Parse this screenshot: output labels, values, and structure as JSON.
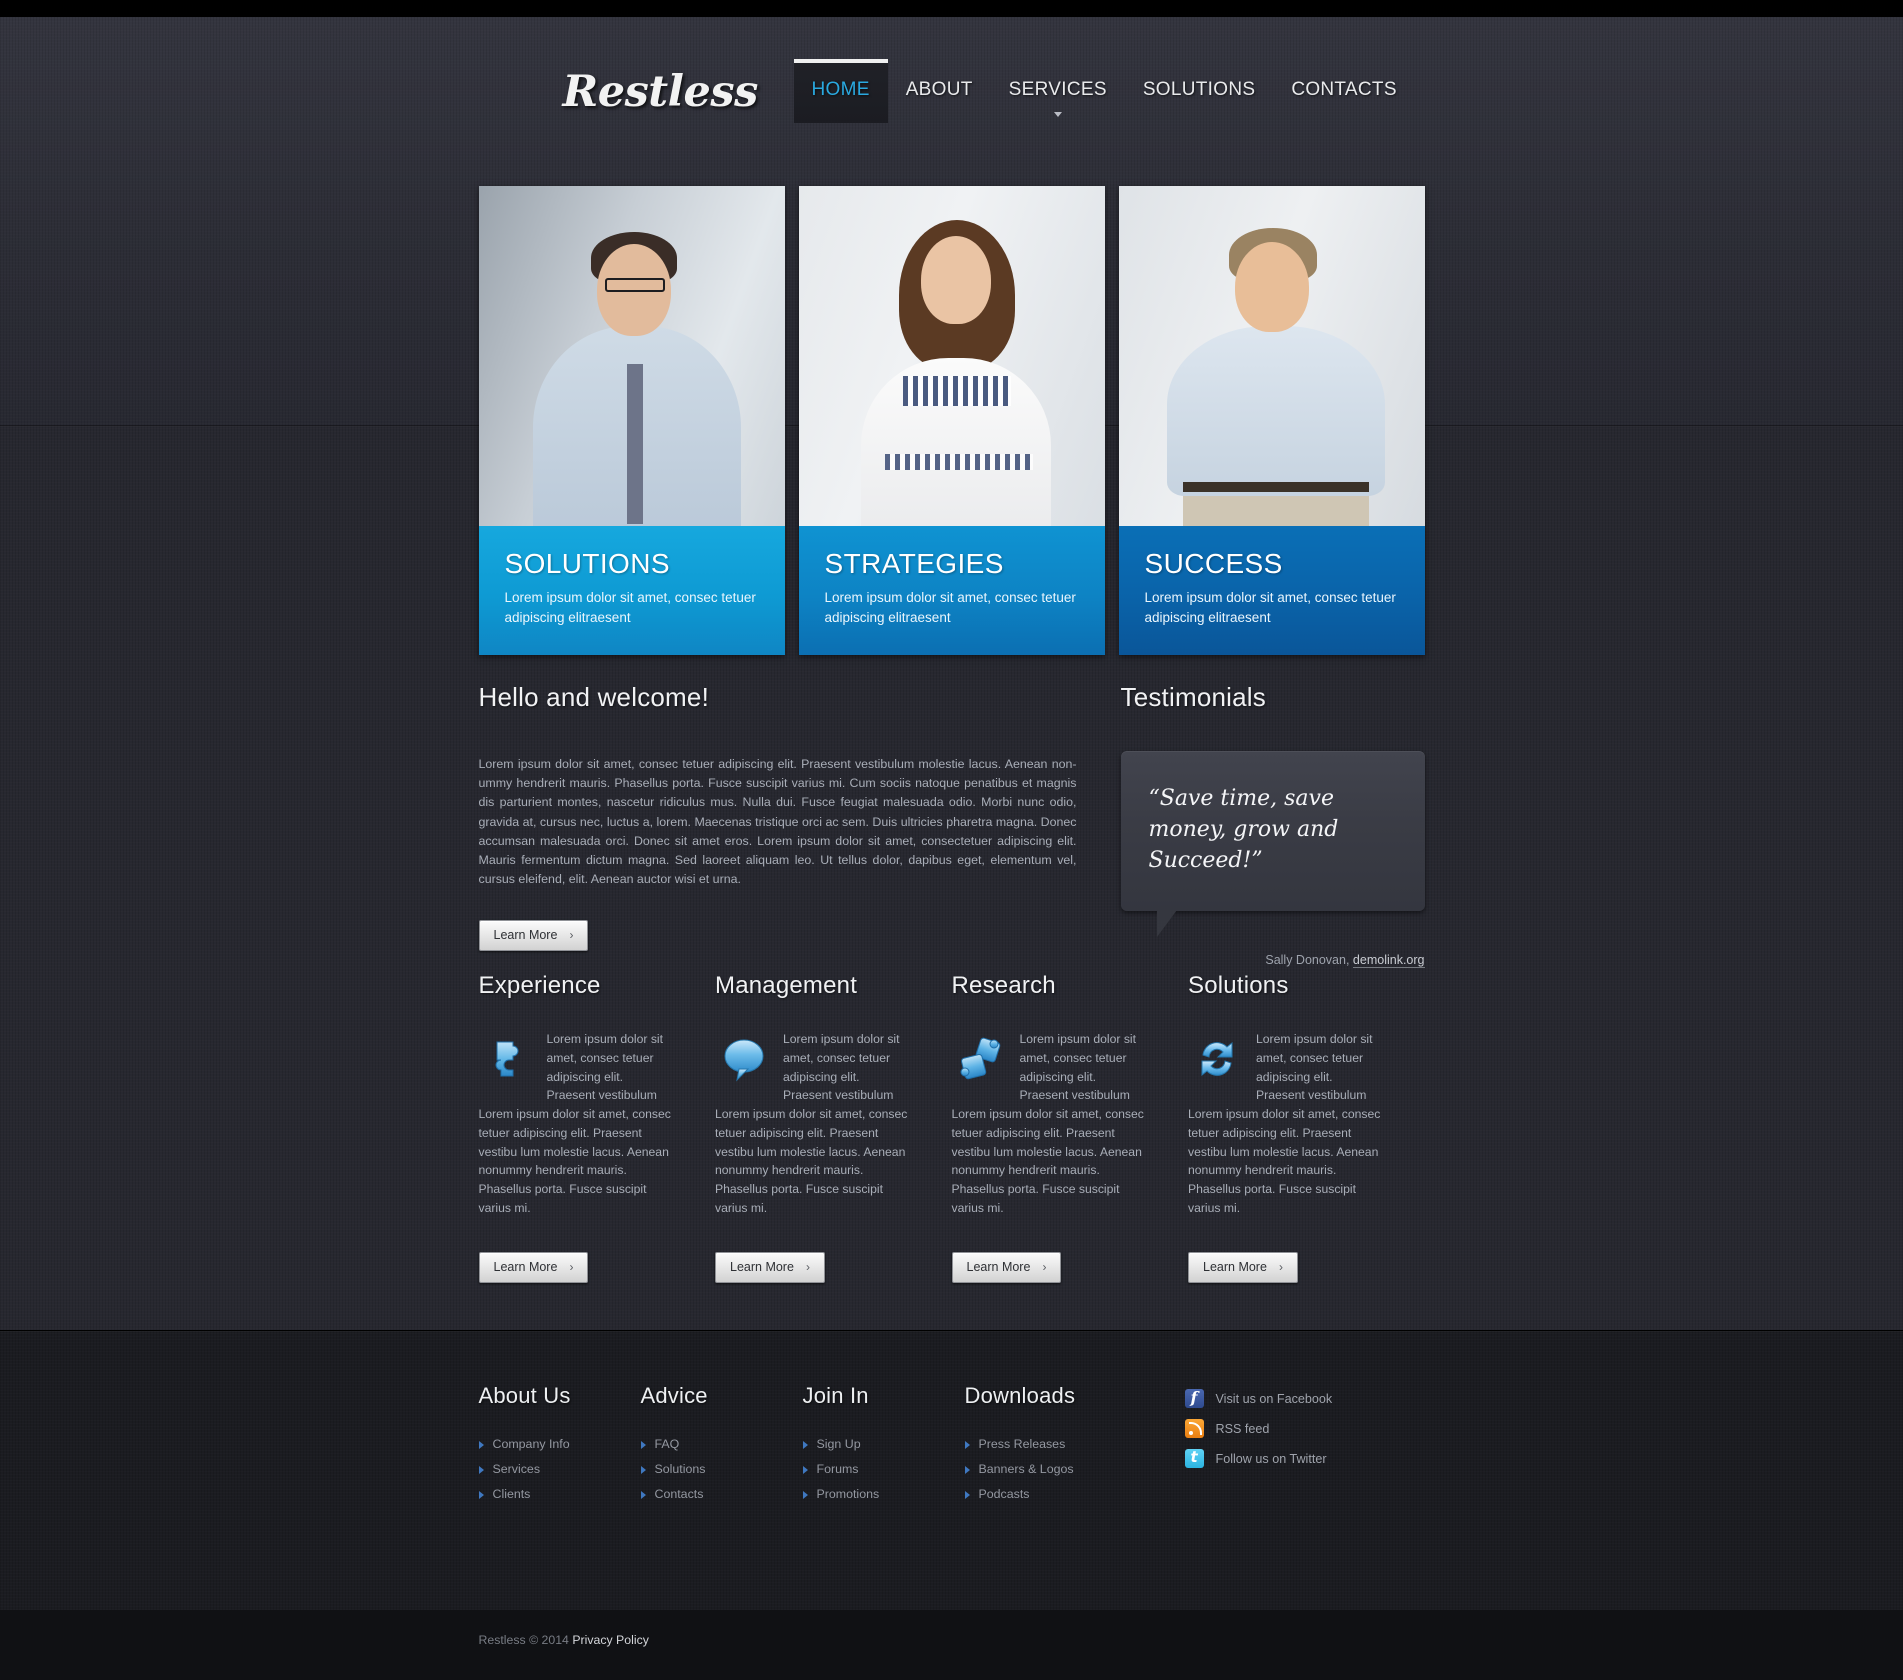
{
  "site": {
    "logo": "Restless",
    "accent_blue": "#2aa9e0",
    "card_blue_1": "#0e9ad3",
    "card_blue_2": "#0d83c4",
    "card_blue_3": "#0a63a9"
  },
  "nav": {
    "items": [
      {
        "label": "HOME",
        "active": true
      },
      {
        "label": "ABOUT",
        "active": false
      },
      {
        "label": "SERVICES",
        "active": false,
        "has_caret": true
      },
      {
        "label": "SOLUTIONS",
        "active": false
      },
      {
        "label": "CONTACTS",
        "active": false
      }
    ]
  },
  "cards": [
    {
      "title": "SOLUTIONS",
      "text": "Lorem ipsum dolor sit amet, consec tetuer adipiscing elitraesent",
      "photo": "man-with-glasses-photo"
    },
    {
      "title": "STRATEGIES",
      "text": "Lorem ipsum dolor sit amet, consec tetuer adipiscing elitraesent",
      "photo": "smiling-woman-photo"
    },
    {
      "title": "SUCCESS",
      "text": "Lorem ipsum dolor sit amet, consec tetuer adipiscing elitraesent",
      "photo": "smiling-man-photo"
    }
  ],
  "welcome": {
    "title": "Hello and welcome!",
    "body": "Lorem ipsum dolor sit amet, consec tetuer adipiscing elit. Praesent vestibulum molestie lacus. Aenean non-ummy hendrerit mauris. Phasellus porta. Fusce suscipit varius mi. Cum sociis natoque penatibus et magnis dis parturient montes, nascetur ridiculus mus. Nulla dui. Fusce feugiat malesuada odio. Morbi nunc odio, gravida at, cursus nec, luctus a, lorem. Maecenas tristique orci ac sem. Duis ultricies pharetra magna. Donec accumsan malesuada orci. Donec sit amet eros. Lorem ipsum dolor sit amet, consectetuer adipiscing elit. Mauris fermentum dictum magna. Sed laoreet aliquam leo. Ut tellus dolor, dapibus eget, elementum vel, cursus eleifend, elit. Aenean auctor wisi et urna.",
    "button": "Learn More",
    "button_arrow": "›"
  },
  "testimonials": {
    "title": "Testimonials",
    "quote": "“Save time, save money, grow and Succeed!”",
    "author": "Sally Donovan,",
    "site": "demolink.org"
  },
  "features": [
    {
      "title": "Experience",
      "icon": "puzzle-piece-icon",
      "intro": "Lorem ipsum dolor sit amet, consec tetuer adipiscing elit. Praesent vestibulum",
      "body": "Lorem ipsum dolor sit amet, consec tetuer adipiscing elit. Praesent vestibu lum molestie lacus. Aenean nonummy hendrerit mauris. Phasellus porta. Fusce suscipit varius mi.",
      "button": "Learn More"
    },
    {
      "title": "Management",
      "icon": "speech-bubble-icon",
      "intro": "Lorem ipsum dolor sit amet, consec tetuer adipiscing elit. Praesent vestibulum",
      "body": "Lorem ipsum dolor sit amet, consec tetuer adipiscing elit. Praesent vestibu lum molestie lacus. Aenean nonummy hendrerit mauris. Phasellus porta. Fusce suscipit varius mi.",
      "button": "Learn More"
    },
    {
      "title": "Research",
      "icon": "two-puzzle-pieces-icon",
      "intro": "Lorem ipsum dolor sit amet, consec tetuer adipiscing elit. Praesent vestibulum",
      "body": "Lorem ipsum dolor sit amet, consec tetuer adipiscing elit. Praesent vestibu lum molestie lacus. Aenean nonummy hendrerit mauris. Phasellus porta. Fusce suscipit varius mi.",
      "button": "Learn More"
    },
    {
      "title": "Solutions",
      "icon": "refresh-arrows-icon",
      "intro": "Lorem ipsum dolor sit amet, consec tetuer adipiscing elit. Praesent vestibulum",
      "body": "Lorem ipsum dolor sit amet, consec tetuer adipiscing elit. Praesent vestibu lum molestie lacus. Aenean nonummy hendrerit mauris. Phasellus porta. Fusce suscipit varius mi.",
      "button": "Learn More"
    }
  ],
  "footer": {
    "columns": [
      {
        "title": "About Us",
        "links": [
          "Company Info",
          "Services",
          "Clients"
        ]
      },
      {
        "title": "Advice",
        "links": [
          "FAQ",
          "Solutions",
          "Contacts"
        ]
      },
      {
        "title": "Join In",
        "links": [
          "Sign Up",
          "Forums",
          "Promotions"
        ]
      },
      {
        "title": "Downloads",
        "links": [
          "Press Releases",
          "Banners & Logos",
          "Podcasts"
        ]
      }
    ],
    "social": [
      {
        "label": "Visit us on Facebook",
        "icon": "facebook-icon"
      },
      {
        "label": "RSS feed",
        "icon": "rss-icon"
      },
      {
        "label": "Follow us on Twitter",
        "icon": "twitter-icon"
      }
    ],
    "copyright": "Restless © 2014",
    "privacy": "Privacy Policy"
  }
}
